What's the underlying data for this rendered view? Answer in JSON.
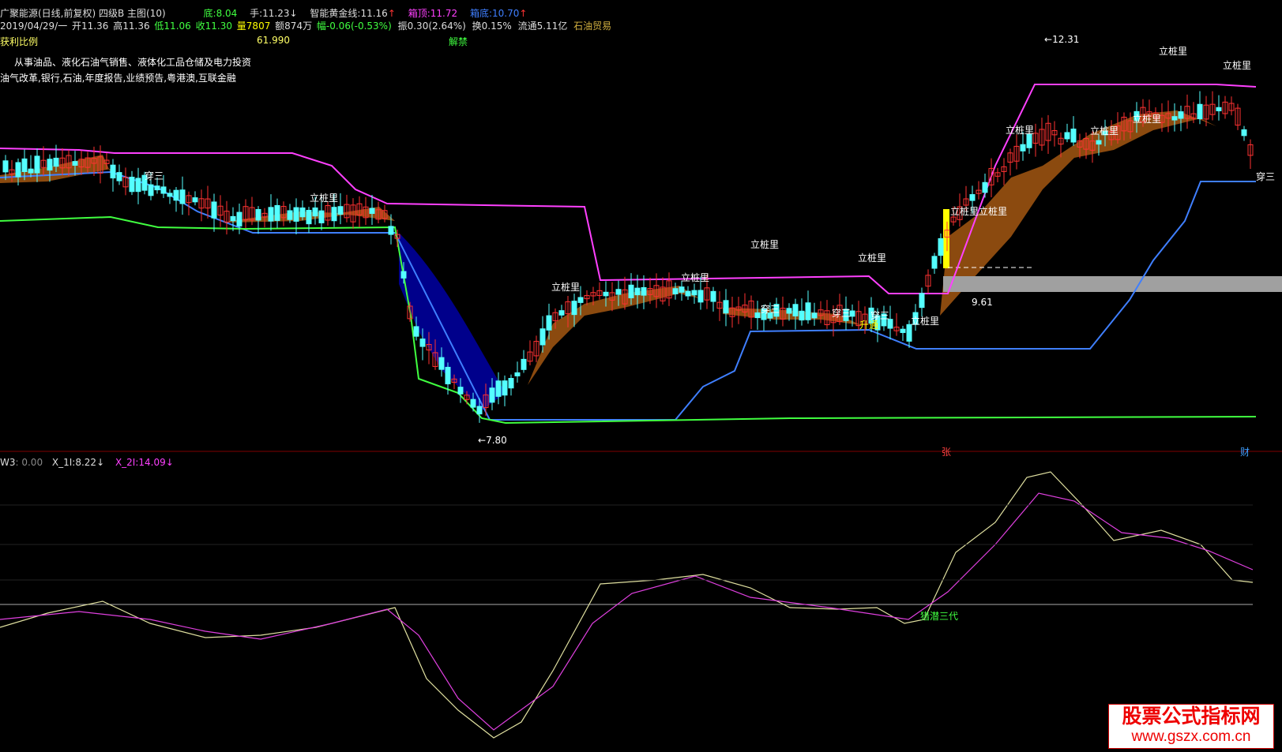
{
  "header": {
    "row1": {
      "title": "广聚能源(日线,前复权) 四级B 主图(10)",
      "bottom_label": "底:",
      "bottom_value": "8.04",
      "hand_label": "手:",
      "hand_value": "11.23",
      "hand_arrow": "↓",
      "gold_label": "智能黄金线:",
      "gold_value": "11.16",
      "gold_arrow": "↑",
      "box_top_label": "箱顶:",
      "box_top_value": "11.72",
      "box_bottom_label": "箱底:",
      "box_bottom_value": "10.70",
      "box_bottom_arrow": "↑"
    },
    "row2": {
      "date": "2019/04/29/一",
      "open": "开11.36",
      "high": "高11.36",
      "low": "低11.06",
      "close": "收11.30",
      "volume": "量7807",
      "amount": "额874万",
      "change": "幅-0.06(-0.53%)",
      "amplitude": "振0.30(2.64%)",
      "turnover": "换0.15%",
      "float": "流通5.11亿",
      "sector": "石油贸易"
    },
    "row3": {
      "profit_label": "获利比例",
      "profit_value": "61.990",
      "unban": "解禁"
    },
    "business": "从事油品、液化石油气销售、液体化工品仓储及电力投资",
    "concepts": "油气改革,银行,石油,年度报告,业绩预告,粤港澳,互联金融"
  },
  "annotations": {
    "high_price": "12.31",
    "low_price": "7.80",
    "pile_label": "立桩里",
    "pile_label2": "立桩里立桩里",
    "cross_label": "穿三",
    "level_price": "9.61",
    "rise_label": "升通",
    "limit_up": "张",
    "finance": "财"
  },
  "sub_panel": {
    "name": "W3",
    "name_value": ": 0.00",
    "x1_label": "X_1I:",
    "x1_value": "8.22",
    "x1_arrow": "↓",
    "x2_label": "X_2I:",
    "x2_value": "14.09",
    "x2_arrow": "↓",
    "signal_label": "猎潜三代"
  },
  "watermark": {
    "title": "股票公式指标网",
    "url": "www.gszx.com.cn"
  },
  "colors": {
    "bull": "#ff3232",
    "bear": "#54ffff",
    "magenta": "#ff40ff",
    "blue_line": "#3f7fff",
    "green_line": "#40ff40",
    "brown_fill": "#8b4a0f",
    "navy_fill": "#00008b",
    "yellow": "#ffff00",
    "gray_band": "#a0a0a0"
  }
}
